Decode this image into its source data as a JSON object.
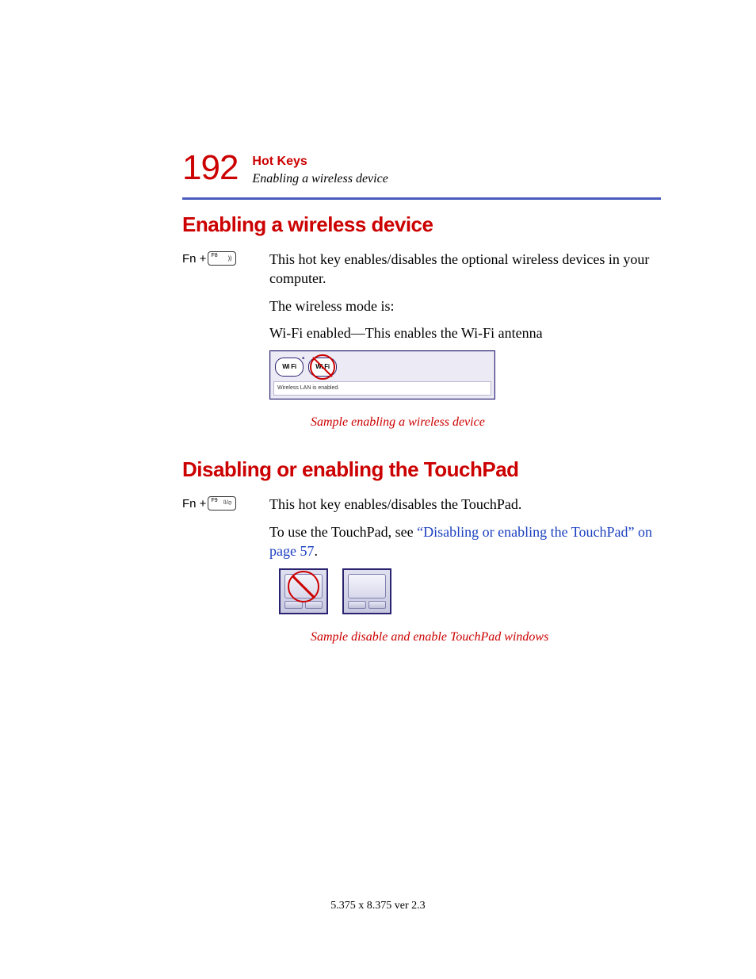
{
  "header": {
    "page_number": "192",
    "chapter": "Hot Keys",
    "breadcrumb": "Enabling a wireless device"
  },
  "section1": {
    "heading": "Enabling a wireless device",
    "fn_prefix": "Fn +",
    "key_label": "F8",
    "p1": "This hot key enables/disables the optional wireless devices in your computer.",
    "p2": "The wireless mode is:",
    "p3": "Wi-Fi enabled—This enables the Wi-Fi antenna",
    "wifi_label": "Wi Fi",
    "wifi_status": "Wireless LAN is enabled.",
    "caption": "Sample enabling a wireless device"
  },
  "section2": {
    "heading": "Disabling or enabling the TouchPad",
    "fn_prefix": "Fn +",
    "key_label": "F9",
    "p1": "This hot key enables/disables the TouchPad.",
    "p2_a": "To use the TouchPad, see ",
    "p2_link": "“Disabling or enabling the TouchPad” on page 57",
    "p2_b": ".",
    "caption": "Sample disable and enable TouchPad windows"
  },
  "footer": "5.375 x 8.375 ver 2.3"
}
